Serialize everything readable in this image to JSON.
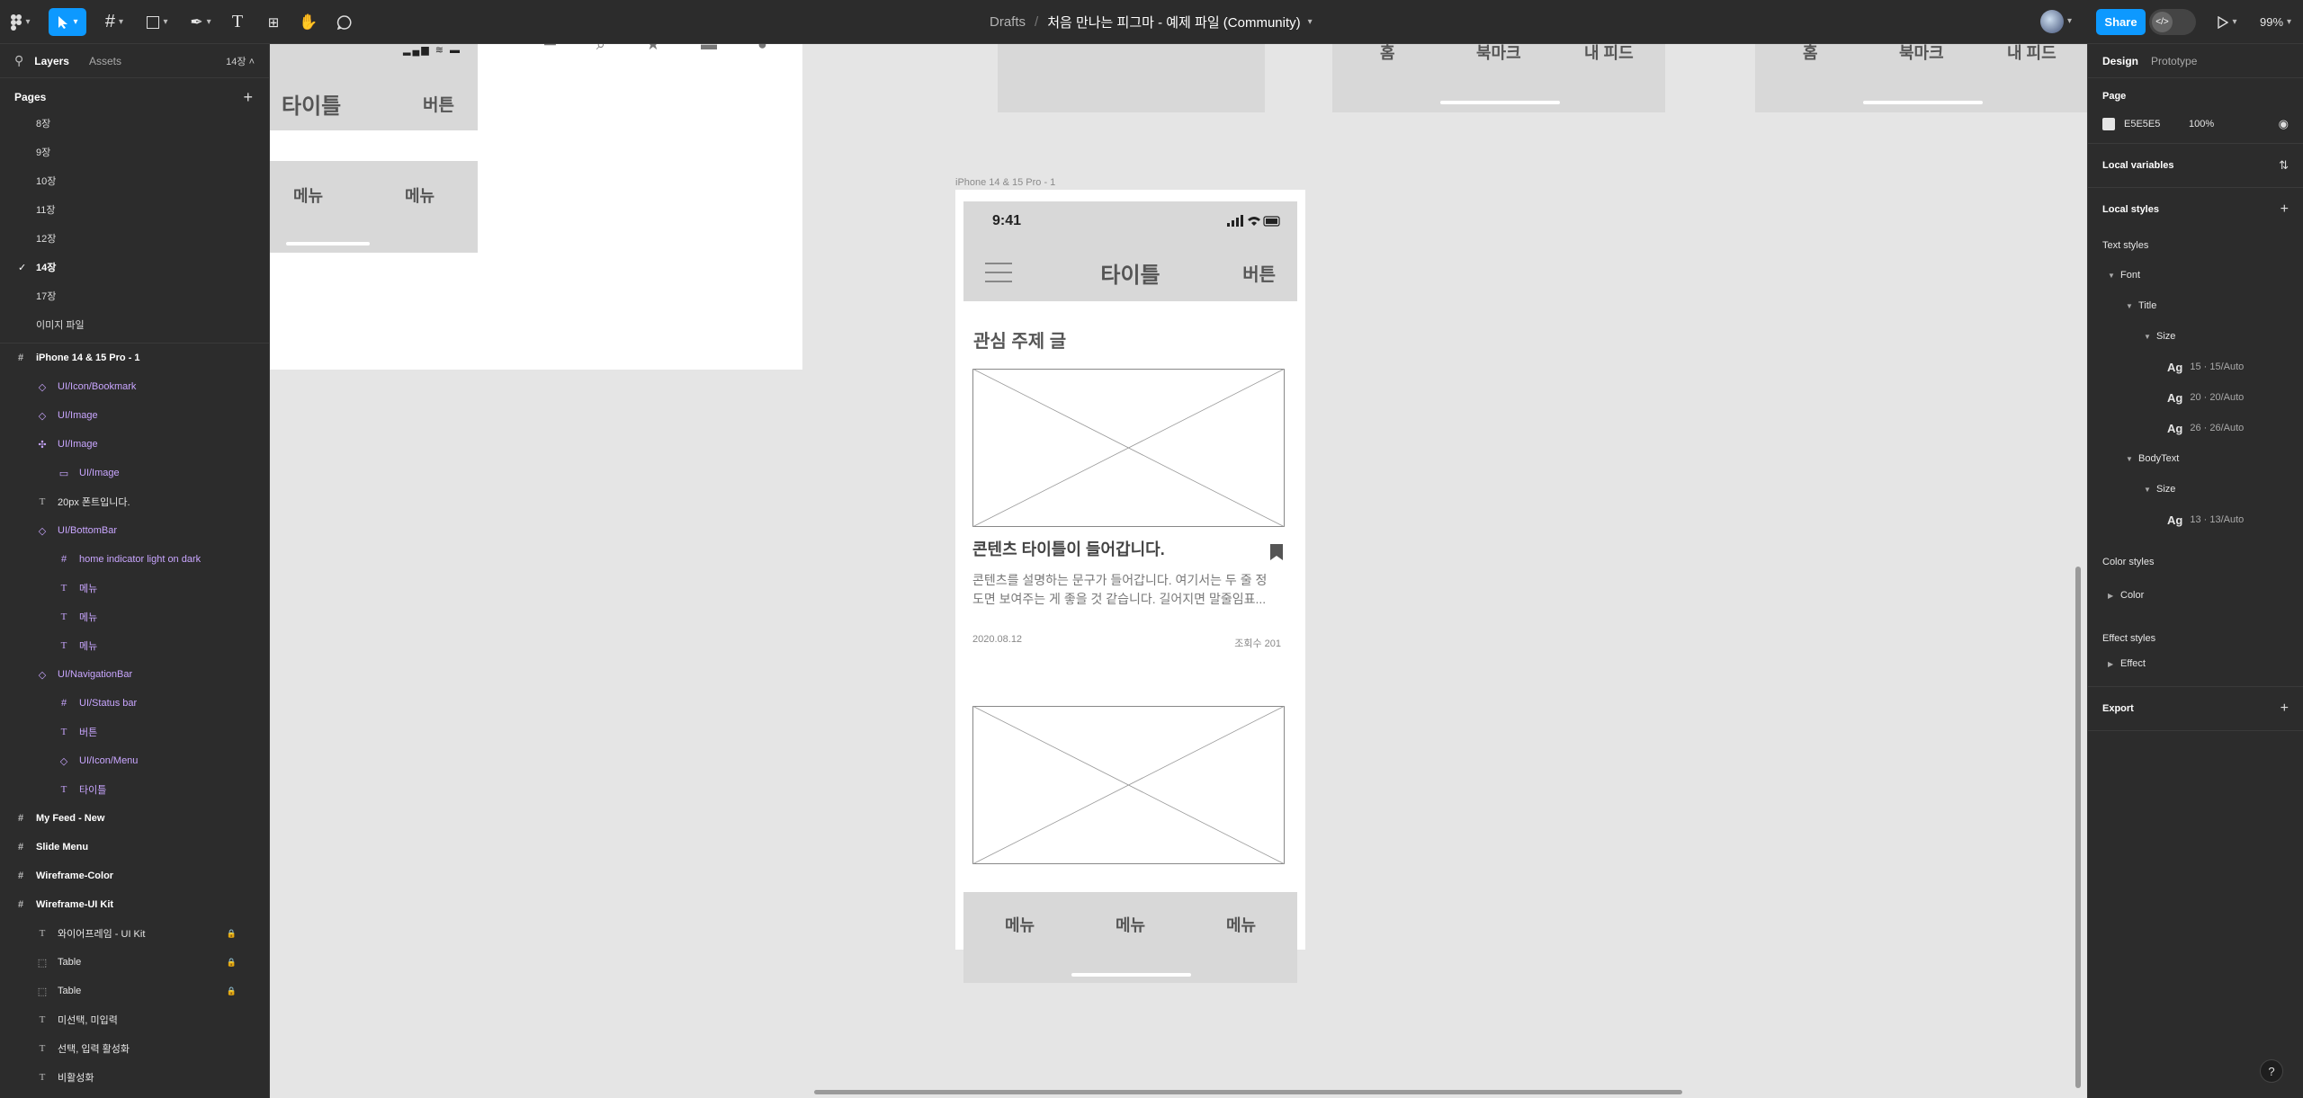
{
  "toolbar": {
    "breadcrumb_drafts": "Drafts",
    "breadcrumb_sep": "/",
    "file_name": "처음 만나는 피그마 - 예제 파일 (Community)",
    "share_label": "Share",
    "zoom": "99%"
  },
  "left_panel": {
    "tab_layers": "Layers",
    "tab_assets": "Assets",
    "page_count": "14장",
    "pages_heading": "Pages",
    "pages": [
      {
        "label": "8장"
      },
      {
        "label": "9장"
      },
      {
        "label": "10장"
      },
      {
        "label": "11장"
      },
      {
        "label": "12장"
      },
      {
        "label": "14장",
        "current": true
      },
      {
        "label": "17장"
      },
      {
        "label": "이미지 파일"
      }
    ],
    "layers": [
      {
        "label": "iPhone 14 & 15 Pro - 1",
        "icon": "frame-icon",
        "depth": 0,
        "type": "frame"
      },
      {
        "label": "UI/Icon/Bookmark",
        "icon": "instance-icon",
        "depth": 1,
        "type": "component"
      },
      {
        "label": "UI/Image",
        "icon": "instance-icon",
        "depth": 1,
        "type": "component"
      },
      {
        "label": "UI/Image",
        "icon": "component-icon",
        "depth": 1,
        "type": "component"
      },
      {
        "label": "UI/Image",
        "icon": "variant-icon",
        "depth": 2,
        "type": "component"
      },
      {
        "label": "20px 폰트입니다.",
        "icon": "text-icon",
        "depth": 1,
        "type": "text"
      },
      {
        "label": "UI/BottomBar",
        "icon": "instance-icon",
        "depth": 1,
        "type": "component"
      },
      {
        "label": "home indicator light on dark",
        "icon": "frame-icon",
        "depth": 2,
        "type": "component"
      },
      {
        "label": "메뉴",
        "icon": "text-icon",
        "depth": 2,
        "type": "component"
      },
      {
        "label": "메뉴",
        "icon": "text-icon",
        "depth": 2,
        "type": "component"
      },
      {
        "label": "메뉴",
        "icon": "text-icon",
        "depth": 2,
        "type": "component"
      },
      {
        "label": "UI/NavigationBar",
        "icon": "instance-icon",
        "depth": 1,
        "type": "component"
      },
      {
        "label": "UI/Status bar",
        "icon": "frame-icon",
        "depth": 2,
        "type": "component"
      },
      {
        "label": "버튼",
        "icon": "text-icon",
        "depth": 2,
        "type": "component"
      },
      {
        "label": "UI/Icon/Menu",
        "icon": "instance-icon",
        "depth": 2,
        "type": "component"
      },
      {
        "label": "타이틀",
        "icon": "text-icon",
        "depth": 2,
        "type": "component"
      },
      {
        "label": "My Feed - New",
        "icon": "frame-icon",
        "depth": 0,
        "type": "frame"
      },
      {
        "label": "Slide Menu",
        "icon": "frame-icon",
        "depth": 0,
        "type": "frame"
      },
      {
        "label": "Wireframe-Color",
        "icon": "frame-icon",
        "depth": 0,
        "type": "frame"
      },
      {
        "label": "Wireframe-UI Kit",
        "icon": "frame-icon",
        "depth": 0,
        "type": "frame"
      },
      {
        "label": "와이어프레임 - UI Kit",
        "icon": "text-icon",
        "depth": 1,
        "type": "text",
        "locked": true
      },
      {
        "label": "Table",
        "icon": "dashed-frame-icon",
        "depth": 1,
        "type": "text",
        "locked": true
      },
      {
        "label": "Table",
        "icon": "dashed-frame-icon",
        "depth": 1,
        "type": "text",
        "locked": true
      },
      {
        "label": "미선택, 미입력",
        "icon": "text-icon",
        "depth": 1,
        "type": "text"
      },
      {
        "label": "선택, 입력 활성화",
        "icon": "text-icon",
        "depth": 1,
        "type": "text"
      },
      {
        "label": "비활성화",
        "icon": "text-icon",
        "depth": 1,
        "type": "text"
      }
    ]
  },
  "canvas": {
    "bg_color": "#E5E5E5",
    "frame_label": "iPhone 14 & 15 Pro - 1",
    "phone": {
      "time": "9:41",
      "nav_title": "타이틀",
      "nav_button": "버튼",
      "section_title": "관심 주제 글",
      "content_title": "콘텐츠 타이틀이 들어갑니다.",
      "content_desc": "콘텐츠를 설명하는 문구가 들어갑니다. 여기서는 두 줄 정도면 보여주는 게 좋을 것 같습니다. 길어지면 말줄임표...",
      "date": "2020.08.12",
      "views": "조회수 201",
      "menus": [
        "메뉴",
        "메뉴",
        "메뉴"
      ]
    },
    "left_frame": {
      "title": "타이틀",
      "button": "버튼",
      "menus": [
        "메뉴",
        "메뉴"
      ]
    },
    "top_frames": {
      "home": "홈",
      "bookmark": "북마크",
      "feed": "내 피드"
    }
  },
  "right_panel": {
    "tab_design": "Design",
    "tab_prototype": "Prototype",
    "page_heading": "Page",
    "page_color_hex": "E5E5E5",
    "page_opacity": "100%",
    "local_variables": "Local variables",
    "local_styles": "Local styles",
    "text_styles": "Text styles",
    "font": "Font",
    "title": "Title",
    "size": "Size",
    "ag": "Ag",
    "title_sizes": [
      {
        "spec": "15 · 15/Auto"
      },
      {
        "spec": "20 · 20/Auto"
      },
      {
        "spec": "26 · 26/Auto"
      }
    ],
    "bodytext": "BodyText",
    "body_sizes": [
      {
        "spec": "13 · 13/Auto"
      }
    ],
    "color_styles": "Color styles",
    "color": "Color",
    "effect_styles": "Effect styles",
    "effect": "Effect",
    "export": "Export"
  },
  "help": "?"
}
